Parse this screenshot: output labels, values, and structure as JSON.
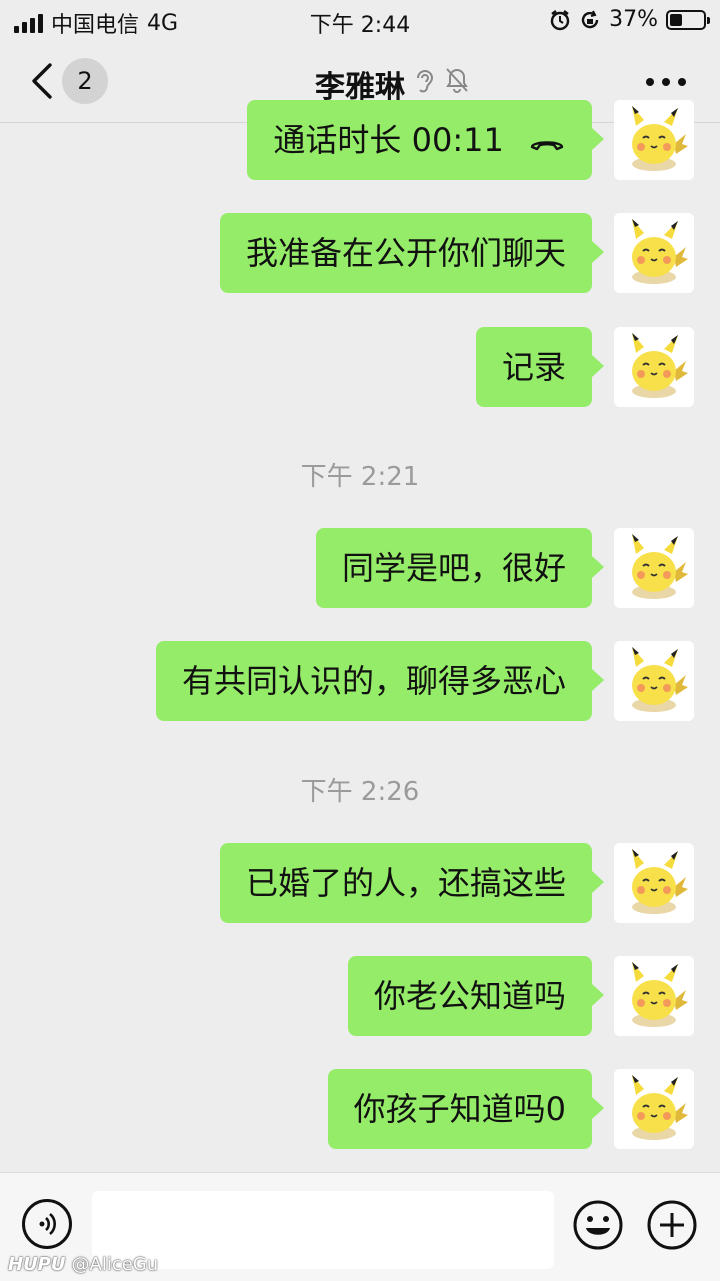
{
  "status_bar": {
    "carrier": "中国电信",
    "network": "4G",
    "time": "下午 2:44",
    "battery": "37%",
    "battery_level": 0.37
  },
  "nav": {
    "unread_badge": "2",
    "title": "李雅琳"
  },
  "messages": [
    {
      "text": "通话时长 00:11",
      "sender": "self",
      "type": "call"
    },
    {
      "text": "我准备在公开你们聊天",
      "sender": "self"
    },
    {
      "text": "记录",
      "sender": "self"
    },
    {
      "text": "同学是吧，很好",
      "sender": "self"
    },
    {
      "text": "有共同认识的，聊得多恶心",
      "sender": "self"
    },
    {
      "text": "已婚了的人，还搞这些",
      "sender": "self"
    },
    {
      "text": "你老公知道吗",
      "sender": "self"
    },
    {
      "text": "你孩子知道吗0",
      "sender": "self"
    }
  ],
  "timestamps": [
    "下午 2:21",
    "下午 2:26"
  ],
  "watermark": {
    "brand": "HUPU",
    "user": "@AliceGu"
  },
  "colors": {
    "bubble": "#95ec69",
    "background": "#ededed"
  }
}
